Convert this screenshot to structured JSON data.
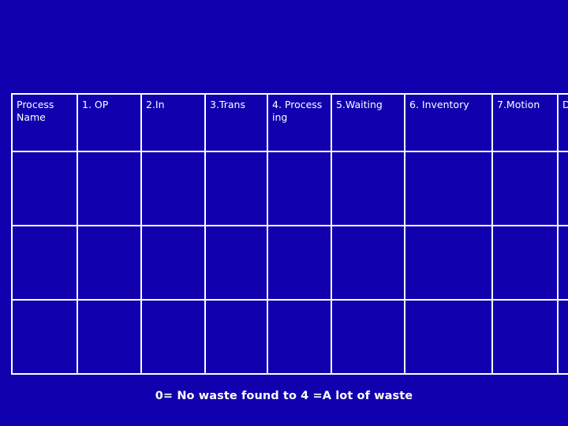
{
  "slide": {
    "background_color": "#1000ad",
    "text_color": "#ffffff",
    "table": {
      "headers": [
        "Process Name",
        "1. OP",
        "2.In",
        "3.Trans",
        "4. Process ing",
        "5.Waiting",
        "6. Inventory",
        "7.Motion",
        "Defects"
      ],
      "rows": [
        [
          "",
          "",
          "",
          "",
          "",
          "",
          "",
          "",
          ""
        ],
        [
          "",
          "",
          "",
          "",
          "",
          "",
          "",
          "",
          ""
        ],
        [
          "",
          "",
          "",
          "",
          "",
          "",
          "",
          "",
          ""
        ]
      ]
    },
    "legend": "0= No waste found  to 4 =A lot of waste"
  }
}
